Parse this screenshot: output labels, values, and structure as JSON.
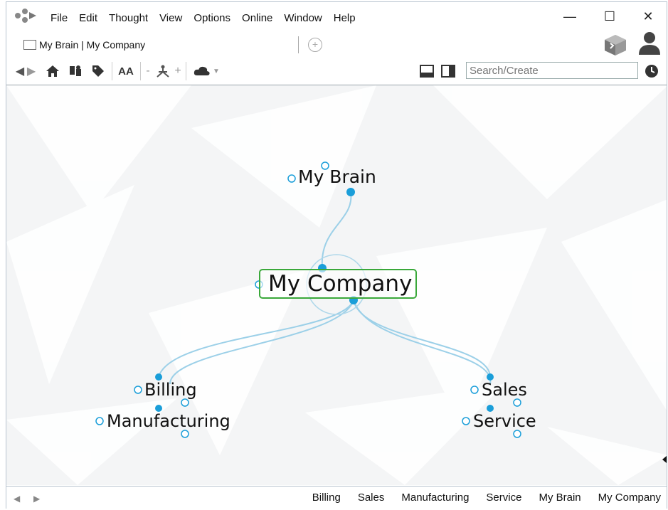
{
  "menu": [
    "File",
    "Edit",
    "Thought",
    "View",
    "Options",
    "Online",
    "Window",
    "Help"
  ],
  "window_controls": {
    "minimize": "—",
    "maximize": "☐",
    "close": "✕"
  },
  "tab": {
    "title": "My Brain | My Company"
  },
  "search": {
    "placeholder": "Search/Create"
  },
  "toolbar": {
    "font_label": "AA",
    "minus": "-",
    "plus": "+"
  },
  "thoughts": {
    "active": "My Company",
    "parent": "My Brain",
    "children": [
      "Billing",
      "Manufacturing",
      "Sales",
      "Service"
    ]
  },
  "breadcrumbs": [
    "Billing",
    "Sales",
    "Manufacturing",
    "Service",
    "My Brain",
    "My Company"
  ],
  "colors": {
    "accent": "#1a9ed9",
    "link": "#8ecae6",
    "active_border": "#3aa83a"
  }
}
